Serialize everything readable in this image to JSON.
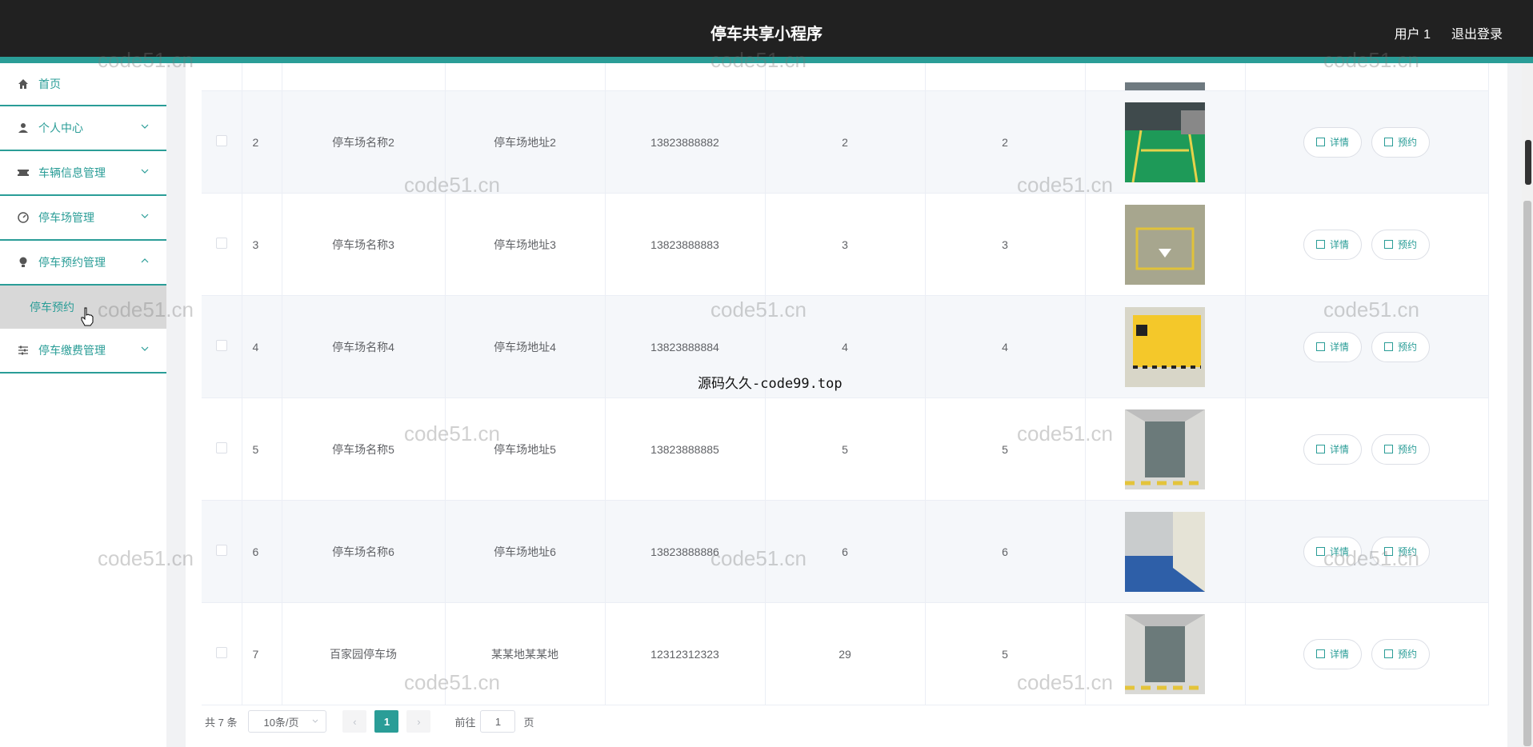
{
  "header": {
    "title": "停车共享小程序",
    "user": "用户 1",
    "logout": "退出登录"
  },
  "sidebar": {
    "items": [
      {
        "label": "首页",
        "icon": "home-icon"
      },
      {
        "label": "个人中心",
        "icon": "user-icon"
      },
      {
        "label": "车辆信息管理",
        "icon": "ticket-icon"
      },
      {
        "label": "停车场管理",
        "icon": "gauge-icon"
      },
      {
        "label": "停车预约管理",
        "icon": "bulb-icon"
      },
      {
        "label": "停车缴费管理",
        "icon": "sliders-icon"
      }
    ],
    "sub_item": "停车预约"
  },
  "table": {
    "rows": [
      {
        "index": "2",
        "name": "停车场名称2",
        "address": "停车场地址2",
        "phone": "13823888882",
        "c5": "2",
        "c6": "2"
      },
      {
        "index": "3",
        "name": "停车场名称3",
        "address": "停车场地址3",
        "phone": "13823888883",
        "c5": "3",
        "c6": "3"
      },
      {
        "index": "4",
        "name": "停车场名称4",
        "address": "停车场地址4",
        "phone": "13823888884",
        "c5": "4",
        "c6": "4"
      },
      {
        "index": "5",
        "name": "停车场名称5",
        "address": "停车场地址5",
        "phone": "13823888885",
        "c5": "5",
        "c6": "5"
      },
      {
        "index": "6",
        "name": "停车场名称6",
        "address": "停车场地址6",
        "phone": "13823888886",
        "c5": "6",
        "c6": "6"
      },
      {
        "index": "7",
        "name": "百家园停车场",
        "address": "某某地某某地",
        "phone": "12312312323",
        "c5": "29",
        "c6": "5"
      }
    ],
    "detail_label": "详情",
    "reserve_label": "预约"
  },
  "pagination": {
    "total": "共 7 条",
    "page_size": "10条/页",
    "current": "1",
    "goto_prefix": "前往",
    "goto_value": "1",
    "goto_suffix": "页"
  },
  "watermarks": {
    "site": "code51.cn",
    "center": "源码久久-code99.top"
  },
  "colors": {
    "accent": "#2a9d97",
    "topbar": "#212121"
  }
}
